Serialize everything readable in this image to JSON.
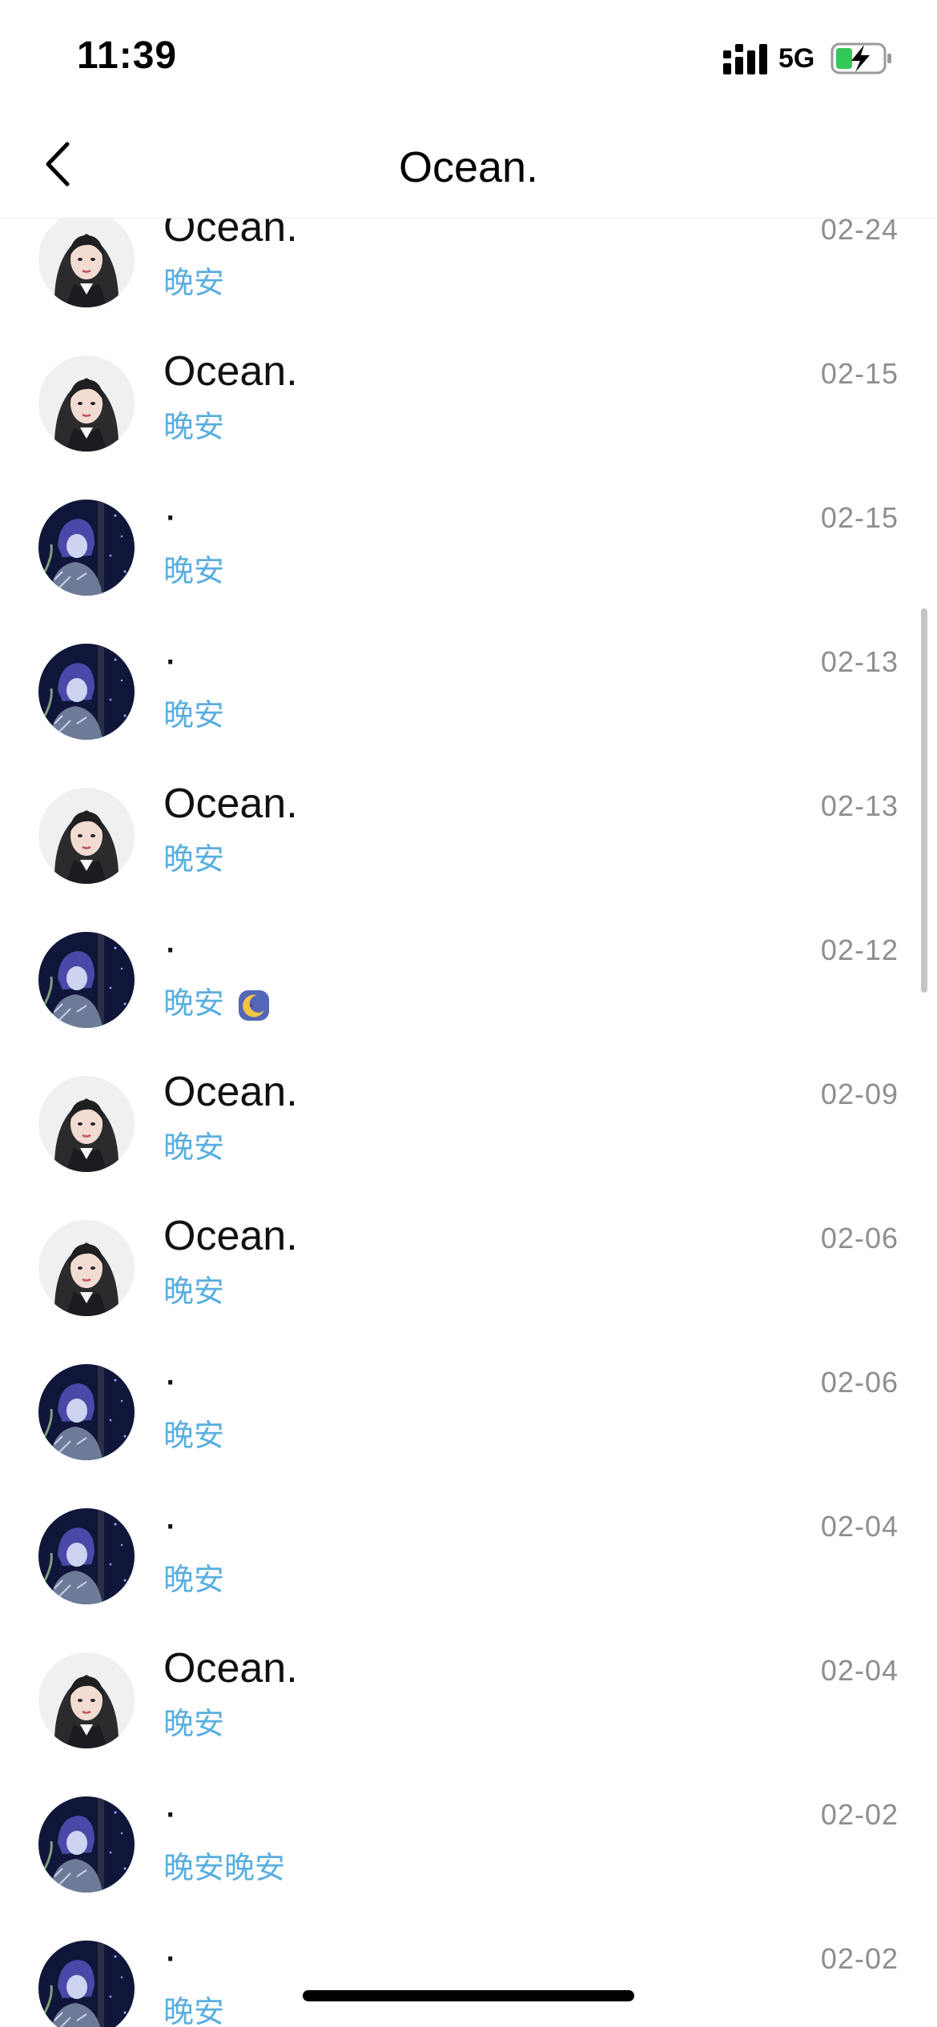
{
  "status_bar": {
    "time": "11:39",
    "network": "5G",
    "battery_state": "charging"
  },
  "nav": {
    "title": "Ocean.",
    "back_icon": "chevron-left-icon"
  },
  "colors": {
    "message_blue": "#5aaee0",
    "date_gray": "#8e8e8e",
    "battery_green": "#34c759"
  },
  "items": [
    {
      "name": "Ocean.",
      "message": "晚安",
      "date": "02-24",
      "avatar": "girl-portrait"
    },
    {
      "name": "Ocean.",
      "message": "晚安",
      "date": "02-15",
      "avatar": "girl-portrait"
    },
    {
      "name": "·",
      "message": "晚安",
      "date": "02-15",
      "avatar": "night-anime"
    },
    {
      "name": "·",
      "message": "晚安",
      "date": "02-13",
      "avatar": "night-anime"
    },
    {
      "name": "Ocean.",
      "message": "晚安",
      "date": "02-13",
      "avatar": "girl-portrait"
    },
    {
      "name": "·",
      "message": "晚安",
      "date": "02-12",
      "avatar": "night-anime",
      "emoji": "moon-emoji"
    },
    {
      "name": "Ocean.",
      "message": "晚安",
      "date": "02-09",
      "avatar": "girl-portrait"
    },
    {
      "name": "Ocean.",
      "message": "晚安",
      "date": "02-06",
      "avatar": "girl-portrait"
    },
    {
      "name": "·",
      "message": "晚安",
      "date": "02-06",
      "avatar": "night-anime"
    },
    {
      "name": "·",
      "message": "晚安",
      "date": "02-04",
      "avatar": "night-anime"
    },
    {
      "name": "Ocean.",
      "message": "晚安",
      "date": "02-04",
      "avatar": "girl-portrait"
    },
    {
      "name": "·",
      "message": "晚安晚安",
      "date": "02-02",
      "avatar": "night-anime"
    },
    {
      "name": "·",
      "message": "晚安",
      "date": "02-02",
      "avatar": "night-anime"
    }
  ]
}
